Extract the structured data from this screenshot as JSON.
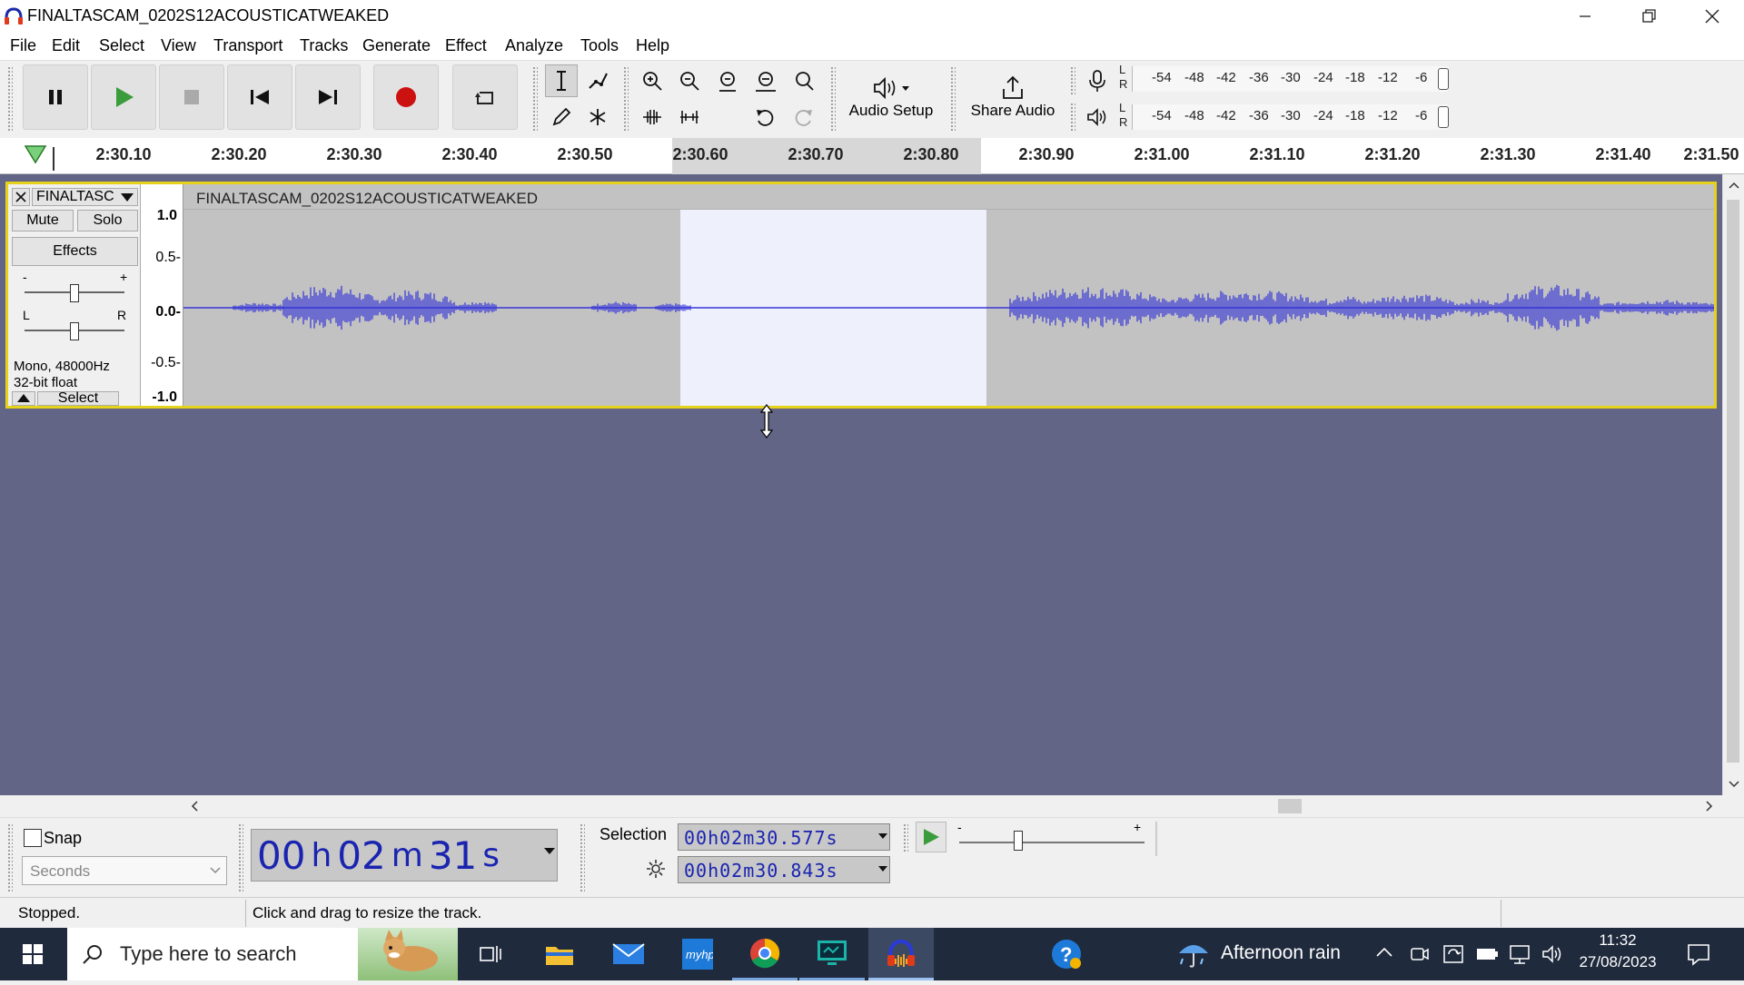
{
  "window": {
    "title": "FINALTASCAM_0202S12ACOUSTICATWEAKED"
  },
  "menu": [
    "File",
    "Edit",
    "Select",
    "View",
    "Transport",
    "Tracks",
    "Generate",
    "Effect",
    "Analyze",
    "Tools",
    "Help"
  ],
  "toolbar": {
    "audio_setup_label": "Audio Setup",
    "share_audio_label": "Share Audio",
    "meter_scale": [
      "-54",
      "-48",
      "-42",
      "-36",
      "-30",
      "-24",
      "-18",
      "-12",
      "-6"
    ],
    "meter_channels": {
      "left": "L",
      "right": "R"
    }
  },
  "ruler": {
    "labels": [
      "2:30.10",
      "2:30.20",
      "2:30.30",
      "2:30.40",
      "2:30.50",
      "2:30.60",
      "2:30.70",
      "2:30.80",
      "2:30.90",
      "2:31.00",
      "2:31.10",
      "2:31.20",
      "2:31.30",
      "2:31.40",
      "2:31.50"
    ]
  },
  "track": {
    "short_name": "FINALTASC",
    "clip_name": "FINALTASCAM_0202S12ACOUSTICATWEAKED",
    "mute_label": "Mute",
    "solo_label": "Solo",
    "effects_label": "Effects",
    "gain_minus": "-",
    "gain_plus": "+",
    "pan_left": "L",
    "pan_right": "R",
    "format_line1": "Mono, 48000Hz",
    "format_line2": "32-bit float",
    "select_label": "Select",
    "scale": [
      "1.0",
      "0.5-",
      "0.0-",
      "-0.5-",
      "-1.0"
    ]
  },
  "bottom": {
    "snap_label": "Snap",
    "snap_checked": false,
    "snap_unit": "Seconds",
    "time_display": {
      "h": "00",
      "h_unit": "h",
      "m": "02",
      "m_unit": "m",
      "s": "31",
      "s_unit": "s"
    },
    "selection_label": "Selection",
    "selection_start": "00h02m30.577s",
    "selection_end": "00h02m30.843s",
    "speed_minus": "-",
    "speed_plus": "+"
  },
  "status": {
    "state": "Stopped.",
    "hint": "Click and drag to resize the track."
  },
  "taskbar": {
    "search_placeholder": "Type here to search",
    "weather": "Afternoon rain",
    "time": "11:32",
    "date": "27/08/2023"
  },
  "colors": {
    "waveform": "#3535d8",
    "track_border": "#e6d21a",
    "selection": "#eef0fb",
    "background": "#636587",
    "record": "#cc1111",
    "play": "#3a9c3a"
  }
}
